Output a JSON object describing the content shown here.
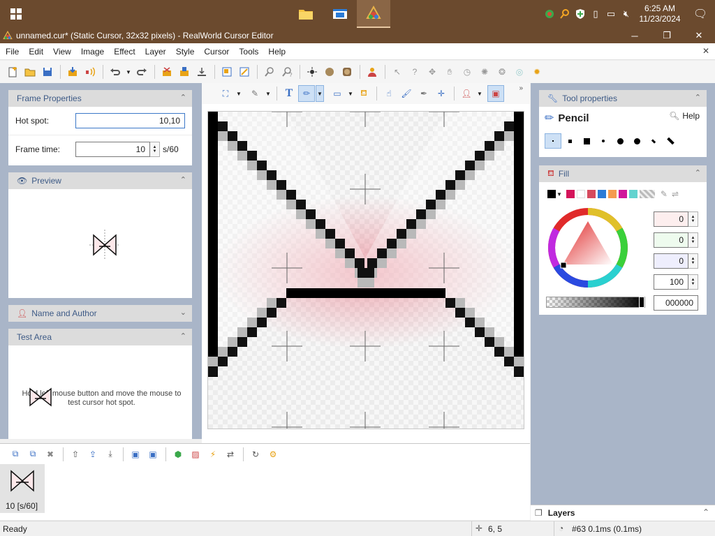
{
  "taskbar": {
    "time": "6:25 AM",
    "date": "11/23/2024"
  },
  "window": {
    "title": "unnamed.cur* (Static Cursor, 32x32 pixels) - RealWorld Cursor Editor"
  },
  "menu": {
    "items": [
      "File",
      "Edit",
      "View",
      "Image",
      "Effect",
      "Layer",
      "Style",
      "Cursor",
      "Tools",
      "Help"
    ]
  },
  "frame_properties": {
    "title": "Frame Properties",
    "hotspot_label": "Hot spot:",
    "hotspot_value": "10,10",
    "frametime_label": "Frame time:",
    "frametime_value": "10",
    "frametime_unit": "s/60"
  },
  "preview": {
    "title": "Preview"
  },
  "name_author": {
    "title": "Name and Author"
  },
  "test_area": {
    "title": "Test Area",
    "hint_line1": "Hold left mouse button and move the mouse to",
    "hint_line2": "test cursor hot spot."
  },
  "tool_properties": {
    "title": "Tool properties",
    "tool_name": "Pencil",
    "help_label": "Help"
  },
  "fill": {
    "title": "Fill",
    "swatches": [
      "#000000",
      "#ffffff",
      "#d4145a",
      "#f2f2f2",
      "#d64a5e",
      "#2b7bd6",
      "#f59b4f",
      "#d0179b",
      "#62d3cf"
    ],
    "channel_values": [
      "0",
      "0",
      "0",
      "100"
    ],
    "hex_value": "000000"
  },
  "frames": {
    "frame_label": "10 [s/60]"
  },
  "layers": {
    "title": "Layers"
  },
  "status": {
    "ready": "Ready",
    "coords": "6, 5",
    "info": "#63 0.1ms (0.1ms)"
  }
}
